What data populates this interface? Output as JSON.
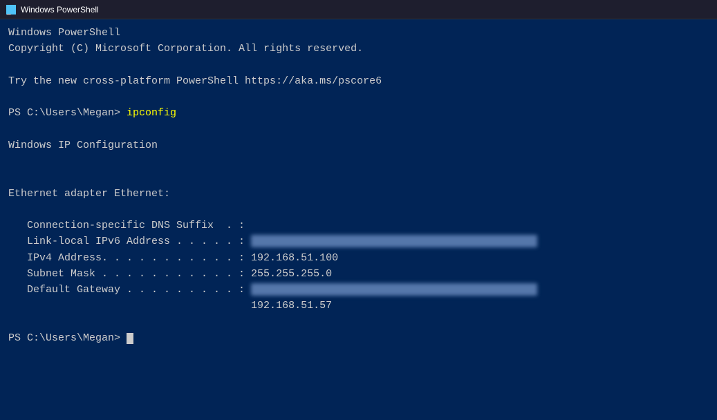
{
  "titleBar": {
    "title": "Windows PowerShell",
    "iconColor": "#4fc3f7"
  },
  "terminal": {
    "line1": "Windows PowerShell",
    "line2": "Copyright (C) Microsoft Corporation. All rights reserved.",
    "line3": "",
    "line4": "Try the new cross-platform PowerShell https://aka.ms/pscore6",
    "line5": "",
    "line6_prefix": "PS C:\\Users\\Megan> ",
    "line6_cmd": "ipconfig",
    "line7": "",
    "line8": "Windows IP Configuration",
    "line9": "",
    "line10": "",
    "line11": "Ethernet adapter Ethernet:",
    "line12": "",
    "line13": "   Connection-specific DNS Suffix  . :",
    "line14_prefix": "   Link-local IPv6 Address . . . . . : ",
    "line14_blurred": "████████████████████████████████████",
    "line15": "   IPv4 Address. . . . . . . . . . . : 192.168.51.100",
    "line16": "   Subnet Mask . . . . . . . . . . . : 255.255.255.0",
    "line17_prefix": "   Default Gateway . . . . . . . . . : ",
    "line17_blurred": "███████████████████████████████████",
    "line18": "                                       192.168.51.57",
    "line19": "",
    "line20_prefix": "PS C:\\Users\\Megan> ",
    "line20_cursor": true
  }
}
